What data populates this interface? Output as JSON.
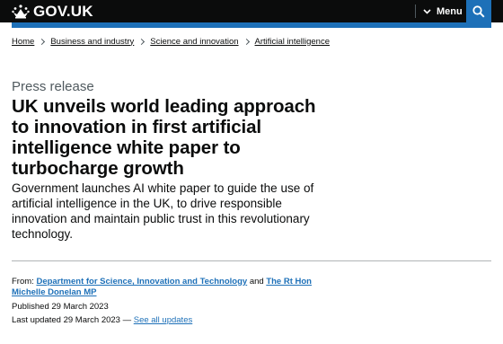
{
  "header": {
    "logo_text": "GOV.UK",
    "menu_label": "Menu",
    "colors": {
      "header_bg": "#0b0c0c",
      "accent": "#1d70b8"
    }
  },
  "breadcrumbs": [
    {
      "label": "Home"
    },
    {
      "label": "Business and industry"
    },
    {
      "label": "Science and innovation"
    },
    {
      "label": "Artificial intelligence"
    }
  ],
  "article": {
    "caption": "Press release",
    "title": "UK unveils world leading approach to innovation in first artificial intelligence white paper to turbocharge growth",
    "lead": "Government launches AI white paper to guide the use of artificial intelligence in the UK, to drive responsible innovation and maintain public trust in this revolutionary technology."
  },
  "metadata": {
    "from_label": "From:",
    "from_org": "Department for Science, Innovation and Technology",
    "and_text": "and",
    "from_person": "The Rt Hon Michelle Donelan MP",
    "published_label": "Published",
    "published_date": "29 March 2023",
    "updated_label": "Last updated",
    "updated_date": "29 March 2023",
    "dash": "—",
    "see_all_updates": "See all updates"
  }
}
